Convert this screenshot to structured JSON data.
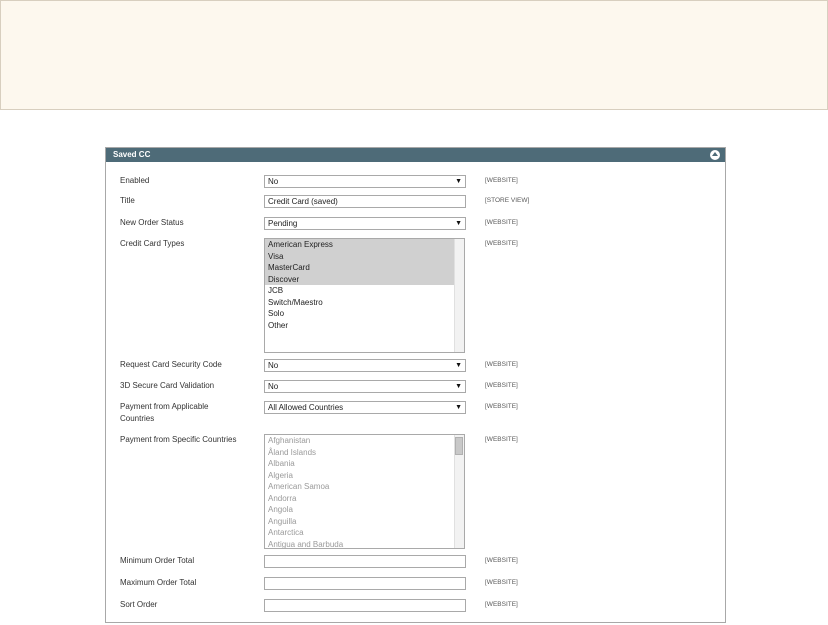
{
  "panel": {
    "title": "Saved CC"
  },
  "fields": {
    "enabled": {
      "label": "Enabled",
      "value": "No",
      "scope": "[WEBSITE]"
    },
    "title": {
      "label": "Title",
      "value": "Credit Card (saved)",
      "scope": "[STORE VIEW]"
    },
    "order_status": {
      "label": "New Order Status",
      "value": "Pending",
      "scope": "[WEBSITE]"
    },
    "cc_types": {
      "label": "Credit Card Types",
      "scope": "[WEBSITE]",
      "options": [
        "American Express",
        "Visa",
        "MasterCard",
        "Discover",
        "JCB",
        "Switch/Maestro",
        "Solo",
        "Other"
      ],
      "selected": [
        "American Express",
        "Visa",
        "MasterCard",
        "Discover"
      ]
    },
    "security_code": {
      "label": "Request Card Security Code",
      "value": "No",
      "scope": "[WEBSITE]"
    },
    "secure_3d": {
      "label": "3D Secure Card Validation",
      "value": "No",
      "scope": "[WEBSITE]"
    },
    "applicable_countries": {
      "label": "Payment from Applicable Countries",
      "value": "All Allowed Countries",
      "scope": "[WEBSITE]"
    },
    "specific_countries": {
      "label": "Payment from Specific Countries",
      "scope": "[WEBSITE]",
      "options": [
        "Afghanistan",
        "Åland Islands",
        "Albania",
        "Algeria",
        "American Samoa",
        "Andorra",
        "Angola",
        "Anguilla",
        "Antarctica",
        "Antigua and Barbuda"
      ]
    },
    "min_total": {
      "label": "Minimum Order Total",
      "value": "",
      "scope": "[WEBSITE]"
    },
    "max_total": {
      "label": "Maximum Order Total",
      "value": "",
      "scope": "[WEBSITE]"
    },
    "sort_order": {
      "label": "Sort Order",
      "value": "",
      "scope": "[WEBSITE]"
    }
  }
}
